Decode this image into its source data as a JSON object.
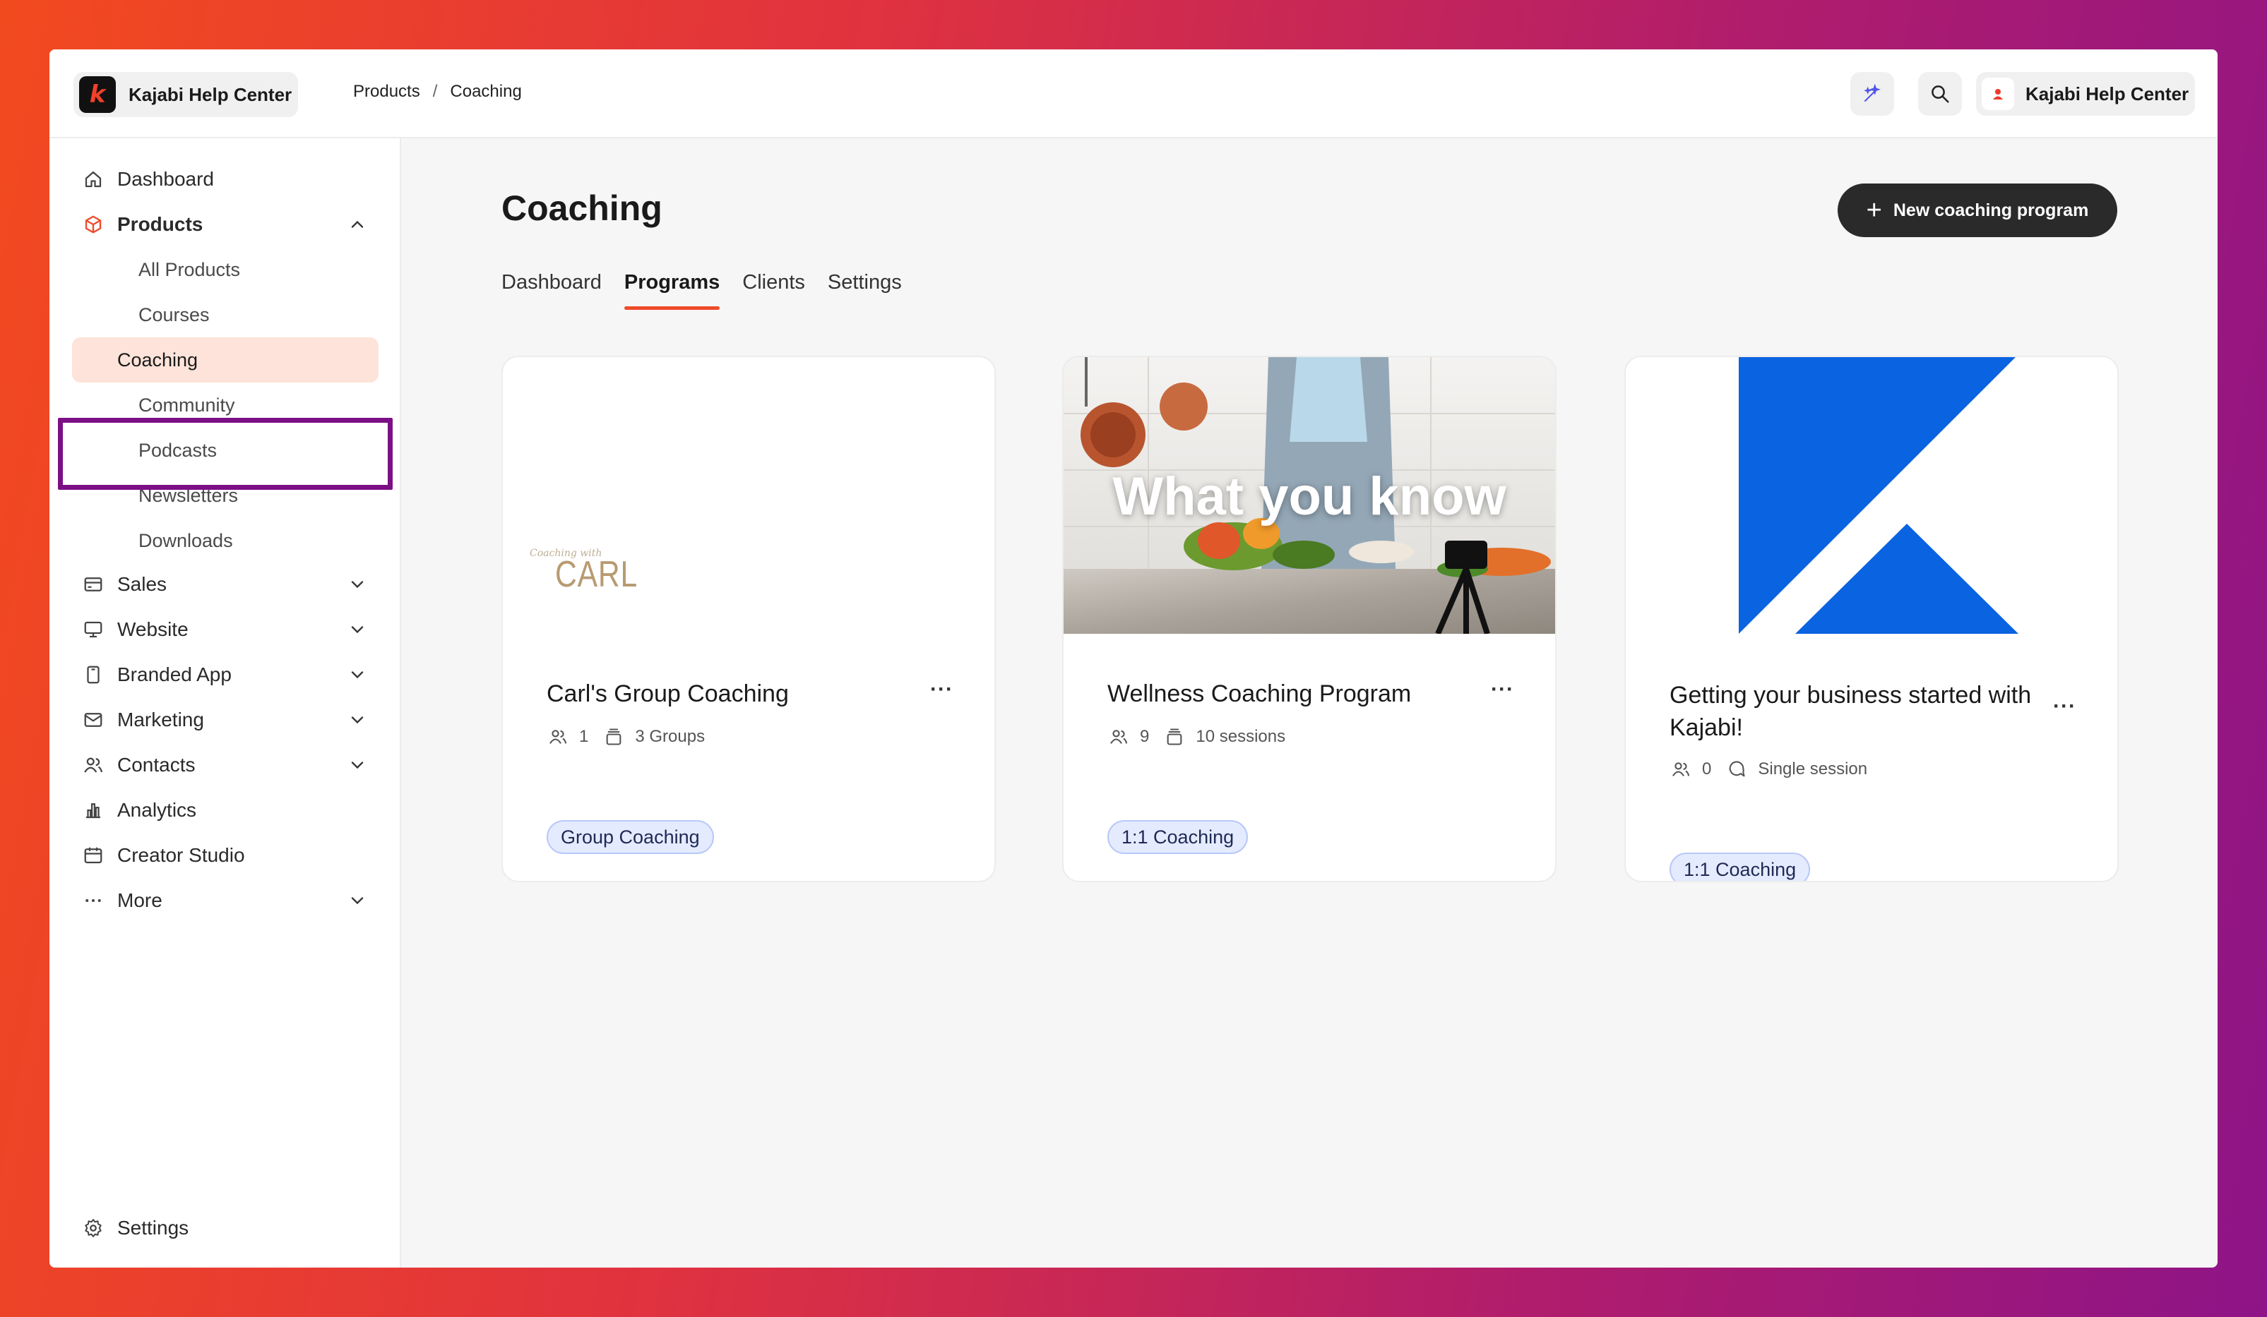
{
  "brand": {
    "name": "Kajabi Help Center",
    "logo_letter": "k"
  },
  "breadcrumb": {
    "items": [
      "Products",
      "Coaching"
    ],
    "separator": "/"
  },
  "account": {
    "name": "Kajabi Help Center"
  },
  "sidebar": {
    "items": [
      {
        "label": "Dashboard",
        "icon": "home-icon"
      },
      {
        "label": "Products",
        "icon": "box-icon",
        "expanded": true
      },
      {
        "label": "Sales",
        "icon": "card-icon"
      },
      {
        "label": "Website",
        "icon": "monitor-icon"
      },
      {
        "label": "Branded App",
        "icon": "phone-icon"
      },
      {
        "label": "Marketing",
        "icon": "mail-icon"
      },
      {
        "label": "Contacts",
        "icon": "people-icon"
      },
      {
        "label": "Analytics",
        "icon": "chart-icon"
      },
      {
        "label": "Creator Studio",
        "icon": "calendar-icon"
      },
      {
        "label": "More",
        "icon": "dots-icon"
      }
    ],
    "sub_items": [
      "All Products",
      "Courses",
      "Coaching",
      "Community",
      "Podcasts",
      "Newsletters",
      "Downloads"
    ],
    "active_sub_item": "Coaching",
    "settings_label": "Settings"
  },
  "page": {
    "title": "Coaching",
    "new_button": "New coaching program",
    "tabs": [
      "Dashboard",
      "Programs",
      "Clients",
      "Settings"
    ],
    "active_tab": "Programs"
  },
  "cards": [
    {
      "title": "Carl's Group Coaching",
      "people": "1",
      "detail": "3 Groups",
      "badge": "Group Coaching",
      "thumb_text": "CARL",
      "thumb_script": "Coaching with"
    },
    {
      "title": "Wellness Coaching Program",
      "people": "9",
      "detail": "10 sessions",
      "badge": "1:1 Coaching",
      "thumb_text": "What you know"
    },
    {
      "title": "Getting your business started with Kajabi!",
      "people": "0",
      "detail": "Single session",
      "badge": "1:1 Coaching"
    }
  ],
  "colors": {
    "accent": "#ef4b2a",
    "active_bg": "#fde3d9",
    "highlight_border": "#7c0f86",
    "badge_bg": "#e4ebff",
    "kajabi_blue": "#0a63e0"
  }
}
